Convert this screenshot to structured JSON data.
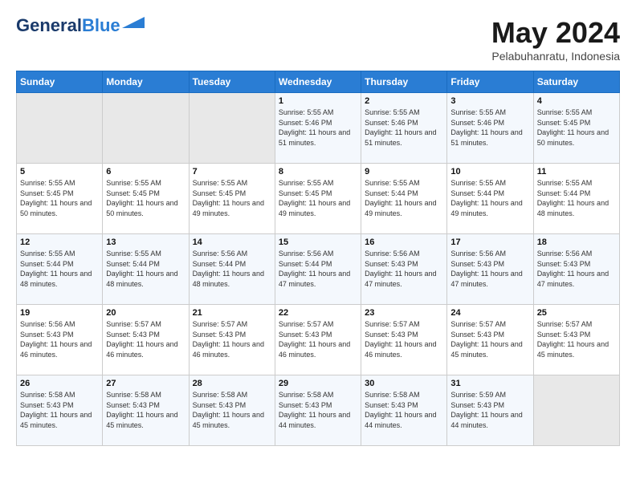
{
  "header": {
    "logo_line1": "General",
    "logo_line2": "Blue",
    "month_title": "May 2024",
    "location": "Pelabuhanratu, Indonesia"
  },
  "weekdays": [
    "Sunday",
    "Monday",
    "Tuesday",
    "Wednesday",
    "Thursday",
    "Friday",
    "Saturday"
  ],
  "weeks": [
    [
      {
        "day": "",
        "sunrise": "",
        "sunset": "",
        "daylight": ""
      },
      {
        "day": "",
        "sunrise": "",
        "sunset": "",
        "daylight": ""
      },
      {
        "day": "",
        "sunrise": "",
        "sunset": "",
        "daylight": ""
      },
      {
        "day": "1",
        "sunrise": "5:55 AM",
        "sunset": "5:46 PM",
        "daylight": "11 hours and 51 minutes."
      },
      {
        "day": "2",
        "sunrise": "5:55 AM",
        "sunset": "5:46 PM",
        "daylight": "11 hours and 51 minutes."
      },
      {
        "day": "3",
        "sunrise": "5:55 AM",
        "sunset": "5:46 PM",
        "daylight": "11 hours and 51 minutes."
      },
      {
        "day": "4",
        "sunrise": "5:55 AM",
        "sunset": "5:45 PM",
        "daylight": "11 hours and 50 minutes."
      }
    ],
    [
      {
        "day": "5",
        "sunrise": "5:55 AM",
        "sunset": "5:45 PM",
        "daylight": "11 hours and 50 minutes."
      },
      {
        "day": "6",
        "sunrise": "5:55 AM",
        "sunset": "5:45 PM",
        "daylight": "11 hours and 50 minutes."
      },
      {
        "day": "7",
        "sunrise": "5:55 AM",
        "sunset": "5:45 PM",
        "daylight": "11 hours and 49 minutes."
      },
      {
        "day": "8",
        "sunrise": "5:55 AM",
        "sunset": "5:45 PM",
        "daylight": "11 hours and 49 minutes."
      },
      {
        "day": "9",
        "sunrise": "5:55 AM",
        "sunset": "5:44 PM",
        "daylight": "11 hours and 49 minutes."
      },
      {
        "day": "10",
        "sunrise": "5:55 AM",
        "sunset": "5:44 PM",
        "daylight": "11 hours and 49 minutes."
      },
      {
        "day": "11",
        "sunrise": "5:55 AM",
        "sunset": "5:44 PM",
        "daylight": "11 hours and 48 minutes."
      }
    ],
    [
      {
        "day": "12",
        "sunrise": "5:55 AM",
        "sunset": "5:44 PM",
        "daylight": "11 hours and 48 minutes."
      },
      {
        "day": "13",
        "sunrise": "5:55 AM",
        "sunset": "5:44 PM",
        "daylight": "11 hours and 48 minutes."
      },
      {
        "day": "14",
        "sunrise": "5:56 AM",
        "sunset": "5:44 PM",
        "daylight": "11 hours and 48 minutes."
      },
      {
        "day": "15",
        "sunrise": "5:56 AM",
        "sunset": "5:44 PM",
        "daylight": "11 hours and 47 minutes."
      },
      {
        "day": "16",
        "sunrise": "5:56 AM",
        "sunset": "5:43 PM",
        "daylight": "11 hours and 47 minutes."
      },
      {
        "day": "17",
        "sunrise": "5:56 AM",
        "sunset": "5:43 PM",
        "daylight": "11 hours and 47 minutes."
      },
      {
        "day": "18",
        "sunrise": "5:56 AM",
        "sunset": "5:43 PM",
        "daylight": "11 hours and 47 minutes."
      }
    ],
    [
      {
        "day": "19",
        "sunrise": "5:56 AM",
        "sunset": "5:43 PM",
        "daylight": "11 hours and 46 minutes."
      },
      {
        "day": "20",
        "sunrise": "5:57 AM",
        "sunset": "5:43 PM",
        "daylight": "11 hours and 46 minutes."
      },
      {
        "day": "21",
        "sunrise": "5:57 AM",
        "sunset": "5:43 PM",
        "daylight": "11 hours and 46 minutes."
      },
      {
        "day": "22",
        "sunrise": "5:57 AM",
        "sunset": "5:43 PM",
        "daylight": "11 hours and 46 minutes."
      },
      {
        "day": "23",
        "sunrise": "5:57 AM",
        "sunset": "5:43 PM",
        "daylight": "11 hours and 46 minutes."
      },
      {
        "day": "24",
        "sunrise": "5:57 AM",
        "sunset": "5:43 PM",
        "daylight": "11 hours and 45 minutes."
      },
      {
        "day": "25",
        "sunrise": "5:57 AM",
        "sunset": "5:43 PM",
        "daylight": "11 hours and 45 minutes."
      }
    ],
    [
      {
        "day": "26",
        "sunrise": "5:58 AM",
        "sunset": "5:43 PM",
        "daylight": "11 hours and 45 minutes."
      },
      {
        "day": "27",
        "sunrise": "5:58 AM",
        "sunset": "5:43 PM",
        "daylight": "11 hours and 45 minutes."
      },
      {
        "day": "28",
        "sunrise": "5:58 AM",
        "sunset": "5:43 PM",
        "daylight": "11 hours and 45 minutes."
      },
      {
        "day": "29",
        "sunrise": "5:58 AM",
        "sunset": "5:43 PM",
        "daylight": "11 hours and 44 minutes."
      },
      {
        "day": "30",
        "sunrise": "5:58 AM",
        "sunset": "5:43 PM",
        "daylight": "11 hours and 44 minutes."
      },
      {
        "day": "31",
        "sunrise": "5:59 AM",
        "sunset": "5:43 PM",
        "daylight": "11 hours and 44 minutes."
      },
      {
        "day": "",
        "sunrise": "",
        "sunset": "",
        "daylight": ""
      }
    ]
  ]
}
